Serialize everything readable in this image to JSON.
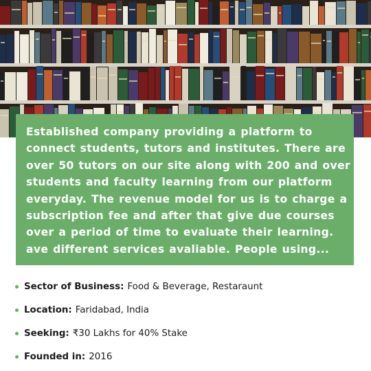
{
  "photo": {
    "icon": "bookshelf-photo"
  },
  "description": {
    "lines": [
      "Established company providing a platform to",
      "connect students, tutors and institutes. There are",
      "over 50 tutors on our site along with 200 and over",
      "students and faculty learning from our platform",
      "everyday. The revenue model for us is to charge a",
      "subscription fee and after that give due courses",
      "over a period of time to evaluate their learning.",
      "ave different services avaliable. People using..."
    ]
  },
  "details": [
    {
      "label": "Sector of Business:",
      "value": "Food & Beverage, Restaraunt"
    },
    {
      "label": "Location:",
      "value": "Faridabad, India"
    },
    {
      "label": "Seeking:",
      "value": "₹30 Lakhs for 40% Stake"
    },
    {
      "label": "Founded in:",
      "value": "2016"
    }
  ],
  "colors": {
    "accent": "#6aae6a",
    "text": "#1b1b1b",
    "card_text": "#ffffff"
  }
}
